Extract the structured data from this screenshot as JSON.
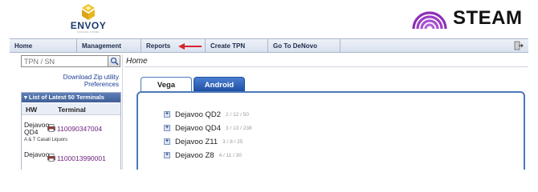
{
  "header": {
    "left_logo": {
      "name": "ENVOY",
      "tagline": "SOURCE STORE"
    },
    "right_logo": {
      "name": "STEAM"
    }
  },
  "nav": {
    "items": [
      "Home",
      "Management",
      "Reports",
      "Create TPN",
      "Go To DeNovo"
    ]
  },
  "search": {
    "placeholder": "TPN / SN"
  },
  "links": {
    "download": "Download Zip utility",
    "preferences": "Preferences"
  },
  "terminals_panel": {
    "title": "List of Latest 50 Terminals",
    "columns": [
      "HW",
      "Terminal"
    ],
    "rows": [
      {
        "hw_line1": "Dejavoo",
        "hw_line2": "QD4",
        "terminal": "110090347004",
        "merchant": "A & T Casali Liquors"
      },
      {
        "hw_line1": "Dejavoo",
        "hw_line2": "",
        "terminal": "1100013990001",
        "merchant": ""
      }
    ]
  },
  "breadcrumb": "Home",
  "tabs": [
    "Vega",
    "Android"
  ],
  "active_tab": "Vega",
  "device_tree": [
    {
      "model": "Dejavoo QD2",
      "counts": "2 / 12 / 50"
    },
    {
      "model": "Dejavoo QD4",
      "counts": "3 / 13 / 238"
    },
    {
      "model": "Dejavoo Z11",
      "counts": "3 / 8 / 25"
    },
    {
      "model": "Dejavoo Z8",
      "counts": "4 / 11 / 30"
    }
  ],
  "colors": {
    "nav_bg": "#d9e1ee",
    "panel_header": "#3f5f96",
    "active_tab_border": "#4b78b8",
    "android_tab": "#1f4fa4",
    "link": "#1d3f9a",
    "terminal_link": "#6a1f7a",
    "steam_logo": "#8b2fb4",
    "envoy_logo": "#e0b21a",
    "annotation_arrow": "#d9232e"
  },
  "icons": [
    "envoy-logo",
    "steam-rainbow-icon",
    "red-arrow-icon",
    "logout-icon",
    "search-icon",
    "printer-icon",
    "expand-plus-icon"
  ]
}
